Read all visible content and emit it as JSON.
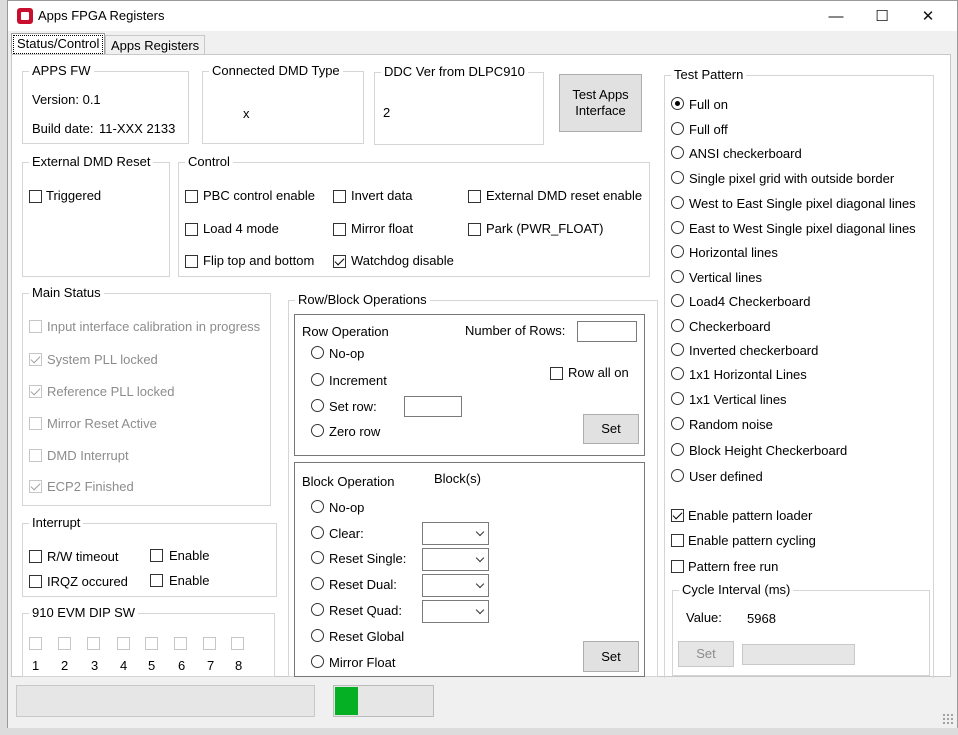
{
  "window": {
    "title": "Apps FPGA Registers",
    "controls": {
      "minimize": "—",
      "maximize": "☐",
      "close": "✕"
    }
  },
  "tabs": [
    {
      "label": "Status/Control"
    },
    {
      "label": "Apps Registers"
    }
  ],
  "apps_fw": {
    "legend": "APPS FW",
    "version": "Version: 0.1",
    "build_date_label": "Build date:",
    "build_date_value": "11-XXX 2133"
  },
  "dmd_type": {
    "legend": "Connected DMD Type",
    "value": "x"
  },
  "ddc_ver": {
    "legend": "DDC Ver from DLPC910",
    "value": "2"
  },
  "test_apps_button": "Test Apps Interface",
  "ext_reset": {
    "legend": "External DMD Reset",
    "triggered": "Triggered"
  },
  "control": {
    "legend": "Control",
    "pbc": "PBC control enable",
    "load4": "Load 4 mode",
    "flip": "Flip top and bottom",
    "invert": "Invert data",
    "mirror_float": "Mirror float",
    "watchdog": "Watchdog disable",
    "ext_reset_enable": "External DMD reset enable",
    "park": "Park (PWR_FLOAT)"
  },
  "main_status": {
    "legend": "Main Status",
    "items": [
      {
        "label": "Input interface calibration in progress",
        "checked": false
      },
      {
        "label": "System PLL locked",
        "checked": true
      },
      {
        "label": "Reference PLL locked",
        "checked": true
      },
      {
        "label": "Mirror Reset Active",
        "checked": false
      },
      {
        "label": "DMD Interrupt",
        "checked": false
      },
      {
        "label": "ECP2 Finished",
        "checked": true
      }
    ]
  },
  "interrupt": {
    "legend": "Interrupt",
    "rw_timeout": "R/W timeout",
    "irqz": "IRQZ occured",
    "enable1": "Enable",
    "enable2": "Enable"
  },
  "dip": {
    "legend": "910 EVM DIP SW",
    "labels": [
      "1",
      "2",
      "3",
      "4",
      "5",
      "6",
      "7",
      "8"
    ]
  },
  "row_block": {
    "legend": "Row/Block Operations",
    "row_op": {
      "legend": "Row Operation",
      "number_of_rows": "Number of Rows:",
      "noop": "No-op",
      "increment": "Increment",
      "set_row": "Set row:",
      "zero_row": "Zero row",
      "row_all_on": "Row all on",
      "set": "Set"
    },
    "block_op": {
      "legend": "Block Operation",
      "blocks_label": "Block(s)",
      "noop": "No-op",
      "clear": "Clear:",
      "reset_single": "Reset Single:",
      "reset_dual": "Reset Dual:",
      "reset_quad": "Reset Quad:",
      "reset_global": "Reset Global",
      "mirror_float": "Mirror Float",
      "set": "Set"
    }
  },
  "test_pattern": {
    "legend": "Test Pattern",
    "options": [
      "Full on",
      "Full off",
      "ANSI checkerboard",
      "Single pixel grid with outside border",
      "West to East Single pixel diagonal lines",
      "East to West Single pixel diagonal lines",
      "Horizontal lines",
      "Vertical lines",
      "Load4 Checkerboard",
      "Checkerboard",
      "Inverted checkerboard",
      "1x1 Horizontal Lines",
      "1x1 Vertical lines",
      "Random noise",
      "Block Height Checkerboard",
      "User defined"
    ],
    "selected": 0,
    "enable_loader": "Enable pattern loader",
    "enable_cycling": "Enable pattern cycling",
    "free_run": "Pattern free run",
    "cycle_interval": {
      "legend": "Cycle Interval (ms)",
      "value_label": "Value:",
      "value": "5968",
      "set": "Set"
    }
  },
  "statusbar": {
    "progress": 0.23
  },
  "colors": {
    "progress": "#06b025"
  }
}
